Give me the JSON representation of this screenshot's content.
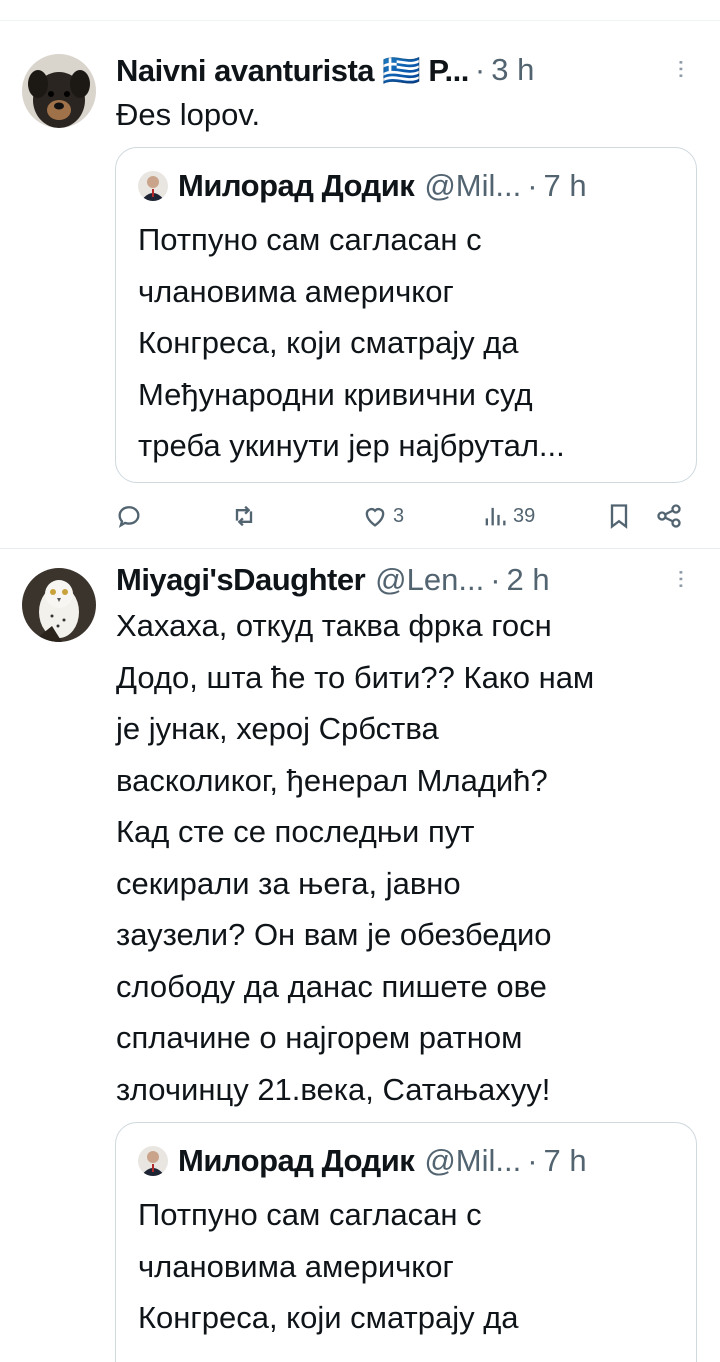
{
  "tweets": [
    {
      "author": "Naivni avanturista 🇬🇷 P...",
      "handle": "",
      "time": "3 h",
      "text": "Đes lopov.",
      "quote": {
        "author": "Милорад Додик",
        "handle": "@Mil...",
        "time": "7 h",
        "text": "Потпуно сам сагласан с\nчлановима америчког\nКонгреса, који сматрају да\nМеђународни кривични суд\nтреба укинути јер најбрутал..."
      },
      "actions": {
        "reply": "",
        "repost": "",
        "likes": "3",
        "views": "39"
      }
    },
    {
      "author": "Miyagi'sDaughter",
      "handle": "@Len...",
      "time": "2 h",
      "text": "Хахаха, откуд таква фрка госн\nДодо, шта ће то бити?? Како нам\nје јунак, херој Србства\nвасколиког, ђенерал Младић?\nКад сте се последњи пут\nсекирали за њега, јавно\nзаузели? Он вам је обезбедио\nслободу да данас пишете ове\nсплачине о најгорем ратном\nзлочинцу 21.века, Сатањахуу!",
      "quote": {
        "author": "Милорад Додик",
        "handle": "@Mil...",
        "time": "7 h",
        "text": "Потпуно сам сагласан с\nчлановима америчког\nКонгреса, који сматрају да"
      }
    }
  ],
  "colors": {
    "text": "#0f1419",
    "secondary": "#536471",
    "border": "#cfd9de"
  },
  "icons": [
    "more-icon",
    "reply-icon",
    "repost-icon",
    "like-icon",
    "views-icon",
    "bookmark-icon",
    "share-icon"
  ]
}
